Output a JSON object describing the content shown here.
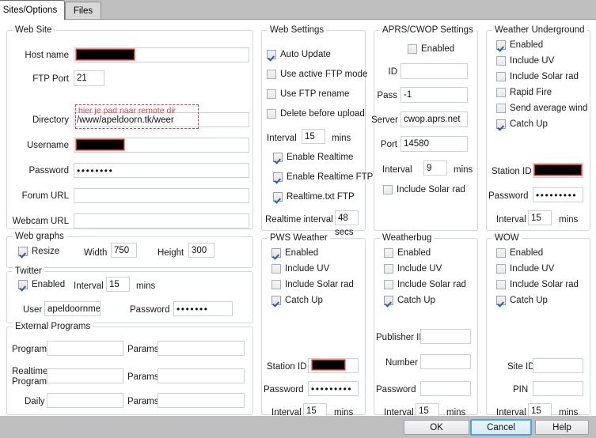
{
  "window": {
    "tabs": [
      {
        "id": "sites",
        "label": "Sites/Options",
        "active": true
      },
      {
        "id": "files",
        "label": "Files",
        "active": false
      }
    ]
  },
  "website": {
    "title": "Web Site",
    "host_label": "Host name",
    "host_value": "",
    "ftpport_label": "FTP Port",
    "ftpport_value": "21",
    "directory_label": "Directory",
    "directory_value": "/www/apeldoorn.tk/weer",
    "directory_annotation": "hier je pad naar remote dir",
    "username_label": "Username",
    "username_value": "",
    "password_label": "Password",
    "password_value": "••••••••",
    "forumurl_label": "Forum URL",
    "forumurl_value": "",
    "webcamurl_label": "Webcam URL",
    "webcamurl_value": ""
  },
  "webgraphs": {
    "title": "Web graphs",
    "resize_label": "Resize",
    "resize_checked": true,
    "width_label": "Width",
    "width_value": "750",
    "height_label": "Height",
    "height_value": "300"
  },
  "twitter": {
    "title": "Twitter",
    "enabled_label": "Enabled",
    "enabled_checked": true,
    "interval_label": "Interval",
    "interval_value": "15",
    "mins_label": "mins",
    "user_label": "User",
    "user_value": "apeldoornmete",
    "password_label": "Password",
    "password_value": "•••••••"
  },
  "external_programs": {
    "title": "External Programs",
    "program_label": "Program",
    "program_value": "",
    "program_params_label": "Params",
    "program_params_value": "",
    "realtime_label_line1": "Realtime",
    "realtime_label_line2": "Program",
    "realtime_value": "",
    "realtime_params_label": "Params",
    "realtime_params_value": "",
    "daily_label": "Daily",
    "daily_value": "",
    "daily_params_label": "Params",
    "daily_params_value": ""
  },
  "web_settings": {
    "title": "Web Settings",
    "auto_update_label": "Auto Update",
    "auto_update_checked": true,
    "active_ftp_label": "Use active FTP mode",
    "active_ftp_checked": false,
    "ftp_rename_label": "Use FTP rename",
    "ftp_rename_checked": false,
    "delete_before_upload_label": "Delete before upload",
    "delete_before_upload_checked": false,
    "interval_label": "Interval",
    "interval_value": "15",
    "mins_label": "mins",
    "enable_realtime_label": "Enable Realtime",
    "enable_realtime_checked": true,
    "enable_realtime_ftp_label": "Enable Realtime FTP",
    "enable_realtime_ftp_checked": true,
    "realtime_txt_ftp_label": "Realtime.txt FTP",
    "realtime_txt_ftp_checked": true,
    "realtime_interval_label": "Realtime interval",
    "realtime_interval_value": "48",
    "secs_label": "secs"
  },
  "pws_weather": {
    "title": "PWS Weather",
    "enabled_label": "Enabled",
    "enabled_checked": true,
    "include_uv_label": "Include UV",
    "include_uv_checked": false,
    "include_solar_label": "Include Solar rad",
    "include_solar_checked": false,
    "catch_up_label": "Catch Up",
    "catch_up_checked": true,
    "station_id_label": "Station ID",
    "station_id_value": "",
    "password_label": "Password",
    "password_value": "•••••••••",
    "interval_label": "Interval",
    "interval_value": "15",
    "mins_label": "mins"
  },
  "aprs_cwop": {
    "title": "APRS/CWOP Settings",
    "enabled_label": "Enabled",
    "enabled_checked": false,
    "id_label": "ID",
    "id_value": "",
    "pass_label": "Pass",
    "pass_value": "-1",
    "server_label": "Server",
    "server_value": "cwop.aprs.net",
    "port_label": "Port",
    "port_value": "14580",
    "interval_label": "Interval",
    "interval_value": "9",
    "mins_label": "mins",
    "include_solar_label": "Include Solar rad",
    "include_solar_checked": false
  },
  "weatherbug": {
    "title": "Weatherbug",
    "enabled_label": "Enabled",
    "enabled_checked": false,
    "include_uv_label": "Include UV",
    "include_uv_checked": false,
    "include_solar_label": "Include Solar rad",
    "include_solar_checked": false,
    "catch_up_label": "Catch Up",
    "catch_up_checked": true,
    "publisher_id_label": "Publisher ID",
    "publisher_id_value": "",
    "number_label": "Number",
    "number_value": "",
    "password_label": "Password",
    "password_value": "",
    "interval_label": "Interval",
    "interval_value": "15",
    "mins_label": "mins"
  },
  "weather_underground": {
    "title": "Weather Underground",
    "enabled_label": "Enabled",
    "enabled_checked": true,
    "include_uv_label": "Include UV",
    "include_uv_checked": false,
    "include_solar_label": "Include Solar rad",
    "include_solar_checked": false,
    "rapid_fire_label": "Rapid Fire",
    "rapid_fire_checked": false,
    "send_average_wind_label": "Send average wind",
    "send_average_wind_checked": false,
    "catch_up_label": "Catch Up",
    "catch_up_checked": true,
    "station_id_label": "Station ID",
    "station_id_value": "",
    "password_label": "Password",
    "password_value": "•••••••••",
    "interval_label": "Interval",
    "interval_value": "15",
    "mins_label": "mins"
  },
  "wow": {
    "title": "WOW",
    "enabled_label": "Enabled",
    "enabled_checked": false,
    "include_uv_label": "Include UV",
    "include_uv_checked": false,
    "include_solar_label": "Include Solar rad",
    "include_solar_checked": false,
    "catch_up_label": "Catch Up",
    "catch_up_checked": true,
    "site_id_label": "Site ID",
    "site_id_value": "",
    "pin_label": "PIN",
    "pin_value": "",
    "interval_label": "Interval",
    "interval_value": "15",
    "mins_label": "mins"
  },
  "buttons": {
    "ok": "OK",
    "cancel": "Cancel",
    "help": "Help"
  },
  "colors": {
    "redaction": "#000000",
    "annotation": "#e8433a",
    "default_button_focus": "#4ba6e8",
    "window_chrome": "#bfbfbf",
    "group_border": "#d3d7de"
  }
}
